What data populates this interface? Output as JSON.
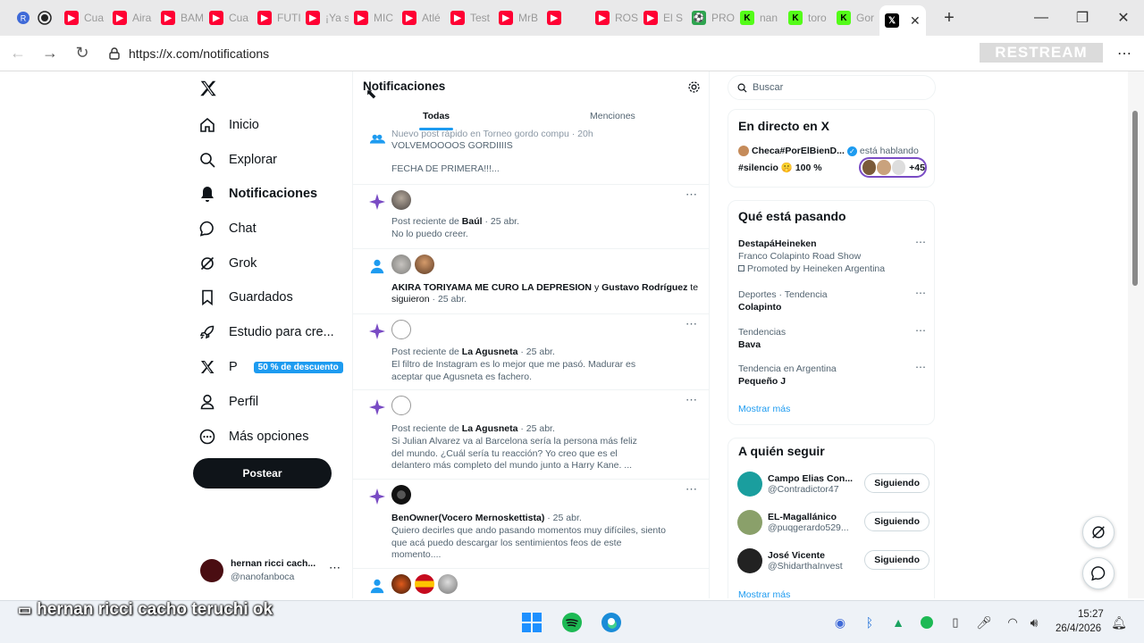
{
  "browser": {
    "tabs": [
      {
        "label": "Cua",
        "color": "#ff0033",
        "icon": "youtube-icon"
      },
      {
        "label": "Aira",
        "color": "#ff0033",
        "icon": "youtube-icon"
      },
      {
        "label": "BAM",
        "color": "#ff0033",
        "icon": "youtube-icon"
      },
      {
        "label": "Cua",
        "color": "#ff0033",
        "icon": "youtube-icon"
      },
      {
        "label": "FUTI",
        "color": "#ff0033",
        "icon": "youtube-icon"
      },
      {
        "label": "¡Ya s",
        "color": "#ff0033",
        "icon": "youtube-icon"
      },
      {
        "label": "MIC",
        "color": "#ff0033",
        "icon": "youtube-icon"
      },
      {
        "label": "Atlé",
        "color": "#ff0033",
        "icon": "youtube-icon"
      },
      {
        "label": "Test",
        "color": "#ff0033",
        "icon": "youtube-icon"
      },
      {
        "label": "MrB",
        "color": "#ff0033",
        "icon": "youtube-icon"
      },
      {
        "label": "",
        "color": "#ff0033",
        "icon": "youtube-icon"
      },
      {
        "label": "ROS",
        "color": "#ff0033",
        "icon": "youtube-icon"
      },
      {
        "label": "El S",
        "color": "#ff0033",
        "icon": "youtube-icon"
      },
      {
        "label": "PRO",
        "color": "#2ea44f",
        "icon": "soccer-icon"
      },
      {
        "label": "nan",
        "color": "#53fc18",
        "icon": "kick-icon"
      },
      {
        "label": "toro",
        "color": "#53fc18",
        "icon": "kick-icon"
      },
      {
        "label": "Gor",
        "color": "#53fc18",
        "icon": "kick-icon"
      }
    ],
    "url": "https://x.com/notifications",
    "watermark": "RESTREAM"
  },
  "sidebar": {
    "items": [
      {
        "label": "Inicio",
        "icon": "home-icon"
      },
      {
        "label": "Explorar",
        "icon": "search-icon"
      },
      {
        "label": "Notificaciones",
        "icon": "bell-icon"
      },
      {
        "label": "Chat",
        "icon": "chat-icon"
      },
      {
        "label": "Grok",
        "icon": "grok-icon"
      },
      {
        "label": "Guardados",
        "icon": "bookmark-icon"
      },
      {
        "label": "Estudio para cre...",
        "icon": "rocket-icon"
      },
      {
        "label": "P",
        "icon": "x-logo-icon",
        "badge": "50 % de descuento"
      },
      {
        "label": "Perfil",
        "icon": "person-icon"
      },
      {
        "label": "Más opciones",
        "icon": "more-circle-icon"
      }
    ],
    "post_label": "Postear",
    "account": {
      "name": "hernan ricci cach...",
      "handle": "@nanofanboca"
    }
  },
  "main": {
    "title": "Notificaciones",
    "tabs": [
      "Todas",
      "Menciones"
    ],
    "notifications": [
      {
        "line1": "Nuevo post rápido en Torneo gordo compu · 20h",
        "line2": "VOLVEMOOOOS GORDIIIIS",
        "line3": "FECHA DE PRIMERA!!!..."
      },
      {
        "prefix": "Post reciente de ",
        "author": "Baúl",
        "date": " · 25 abr.",
        "body": "No lo puedo creer."
      },
      {
        "a1": "AKIRA TORIYAMA ME CURO LA DEPRESION",
        "mid": " y ",
        "a2": "Gustavo Rodríguez",
        "suffix": " te",
        "line2": "siguieron",
        "date": " · 25 abr."
      },
      {
        "prefix": "Post reciente de ",
        "author": "La Agusneta",
        "date": " · 25 abr.",
        "body": "El filtro de Instagram es lo mejor que me pasó. Madurar es aceptar que Agusneta es fachero."
      },
      {
        "prefix": "Post reciente de ",
        "author": "La Agusneta",
        "date": " · 25 abr.",
        "body": "Si Julian Alvarez va al Barcelona sería la persona más feliz del mundo. ¿Cuál sería tu reacción? Yo creo que es el delantero más completo del mundo junto a Harry Kane. ..."
      },
      {
        "author": "BenOwner(Vocero Mernoskettista)",
        "date": " · 25 abr.",
        "body": "Quiero decirles que ando pasando momentos muy difíciles, siento que acá puedo descargar los sentimientos feos de este momento...."
      }
    ]
  },
  "right": {
    "search_placeholder": "Buscar",
    "live": {
      "title": "En directo en X",
      "host": "Checa#PorElBienD...",
      "status": "está hablando",
      "topic": "#silencio 🤫 100 %",
      "count": "+45"
    },
    "trending": {
      "title": "Qué está pasando",
      "items": [
        {
          "context": "",
          "name": "DestapáHeineken",
          "sub1": "Franco Colapinto Road Show",
          "sub2": "Promoted by Heineken Argentina"
        },
        {
          "context": "Deportes · Tendencia",
          "name": "Colapinto"
        },
        {
          "context": "Tendencias",
          "name": "Bava"
        },
        {
          "context": "Tendencia en Argentina",
          "name": "Pequeño J"
        }
      ],
      "show_more": "Mostrar más"
    },
    "follow": {
      "title": "A quién seguir",
      "items": [
        {
          "name": "Campo Elias Con...",
          "handle": "@Contradictor47",
          "button": "Siguiendo",
          "color": "#1a9e9e"
        },
        {
          "name": "EL-Magallánico",
          "handle": "@puqgerardo529...",
          "button": "Siguiendo",
          "color": "#8aa06a"
        },
        {
          "name": "José Vicente",
          "handle": "@ShidarthaInvest",
          "button": "Siguiendo",
          "color": "#222222"
        }
      ],
      "show_more": "Mostrar más"
    }
  },
  "caption": "hernan ricci cacho teruchi ok",
  "taskbar": {
    "time": "15:27",
    "date": "26/4/2026"
  }
}
